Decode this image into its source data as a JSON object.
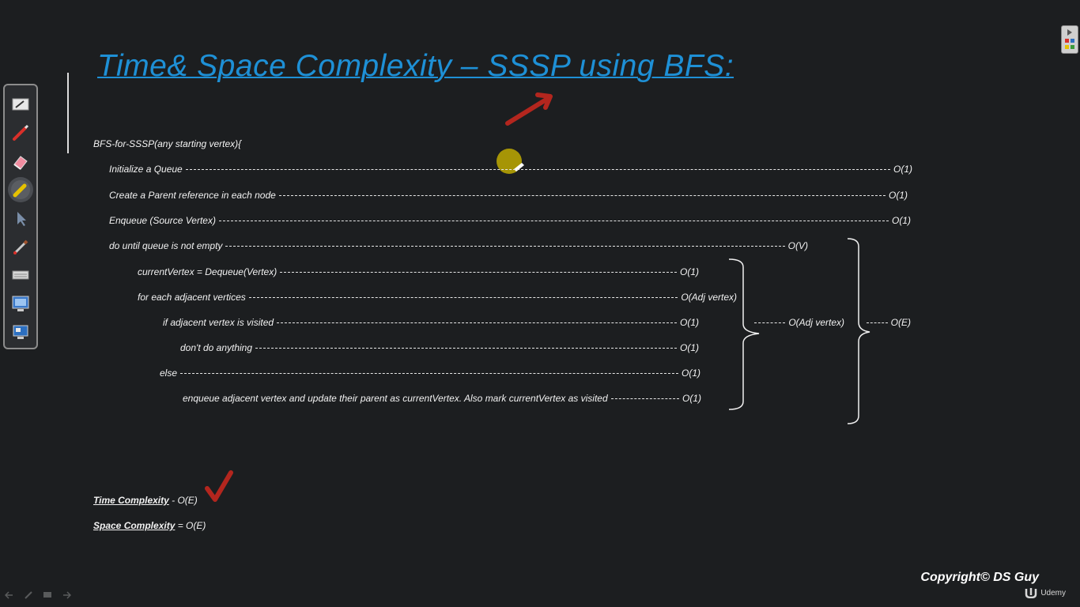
{
  "title": "Time& Space Complexity – SSSP using BFS:",
  "algorithm": {
    "header": "BFS-for-SSSP(any starting vertex){",
    "lines": [
      {
        "text": "Initialize a Queue",
        "cost": "O(1)"
      },
      {
        "text": "Create a Parent reference in each node",
        "cost": "O(1)"
      },
      {
        "text": "Enqueue (Source Vertex)",
        "cost": "O(1)"
      },
      {
        "text": "do until queue is not empty",
        "cost": "O(V)"
      },
      {
        "text": "currentVertex = Dequeue(Vertex)",
        "cost": "O(1)"
      },
      {
        "text": "for each adjacent vertices",
        "cost": "O(Adj vertex)"
      },
      {
        "text": "if adjacent vertex is visited",
        "cost": "O(1)"
      },
      {
        "text": "don't do anything",
        "cost": "O(1)"
      },
      {
        "text": "else",
        "cost": "O(1)"
      },
      {
        "text": "enqueue adjacent vertex and update their parent as currentVertex. Also mark currentVertex as visited",
        "cost": "O(1)"
      }
    ],
    "inner_brace_label": "O(Adj vertex)",
    "outer_brace_label": "O(E)"
  },
  "summary": {
    "time_label": "Time Complexity",
    "time_value": " - O(E)",
    "space_label": "Space Complexity",
    "space_value": " = O(E)"
  },
  "copyright": "Copyright© DS Guy",
  "brand": "Udemy",
  "colors": {
    "title": "#1e90d6",
    "annotation": "#b3261e",
    "background": "#1c1e20"
  },
  "toolbar": {
    "tools": [
      "whiteboard-icon",
      "pen-icon",
      "eraser-icon",
      "highlighter-icon",
      "select-arrow-icon",
      "brush-icon",
      "keyboard-icon",
      "screen-capture-icon",
      "desktop-icon"
    ]
  }
}
